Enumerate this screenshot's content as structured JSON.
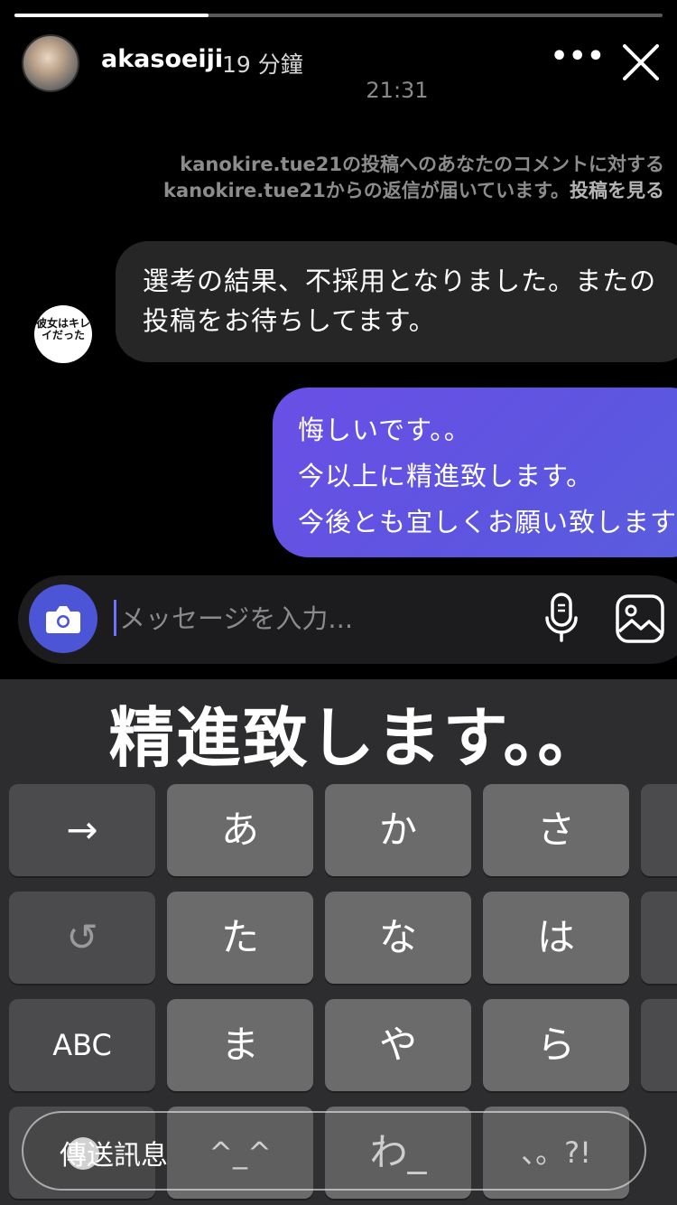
{
  "story": {
    "progress": 0.3,
    "username": "akasoeiji",
    "time_ago": "19 分鐘",
    "more_label": "•••"
  },
  "chat": {
    "timestamp": "21:31",
    "notice_line1": "kanokire.tue21の投稿へのあなたのコメントに対する",
    "notice_line2": "kanokire.tue21からの返信が届いています。",
    "notice_link": "投稿を見る",
    "sender_avatar_text": "彼女はキレイだった",
    "incoming_message": "選考の結果、不採用となりました。またの投稿をお待ちしてます。",
    "outgoing_lines": [
      "悔しいです。。",
      "今以上に精進致します。",
      "今後とも宜しくお願い致します"
    ]
  },
  "composer": {
    "placeholder": "メッセージを入力..."
  },
  "caption": "精進致します。。",
  "keyboard": {
    "row1": [
      "→",
      "あ",
      "か",
      "さ"
    ],
    "row2": [
      "↺",
      "た",
      "な",
      "は"
    ],
    "row3": [
      "ABC",
      "ま",
      "や",
      "ら"
    ],
    "row4": [
      "",
      "^_^",
      "わ_",
      "、。?!"
    ]
  },
  "send_label": "傳送訊息",
  "colors": {
    "outgoing_bubble": "#5d55e0",
    "camera_button": "#4b55d6",
    "incoming_bubble": "#262626"
  }
}
